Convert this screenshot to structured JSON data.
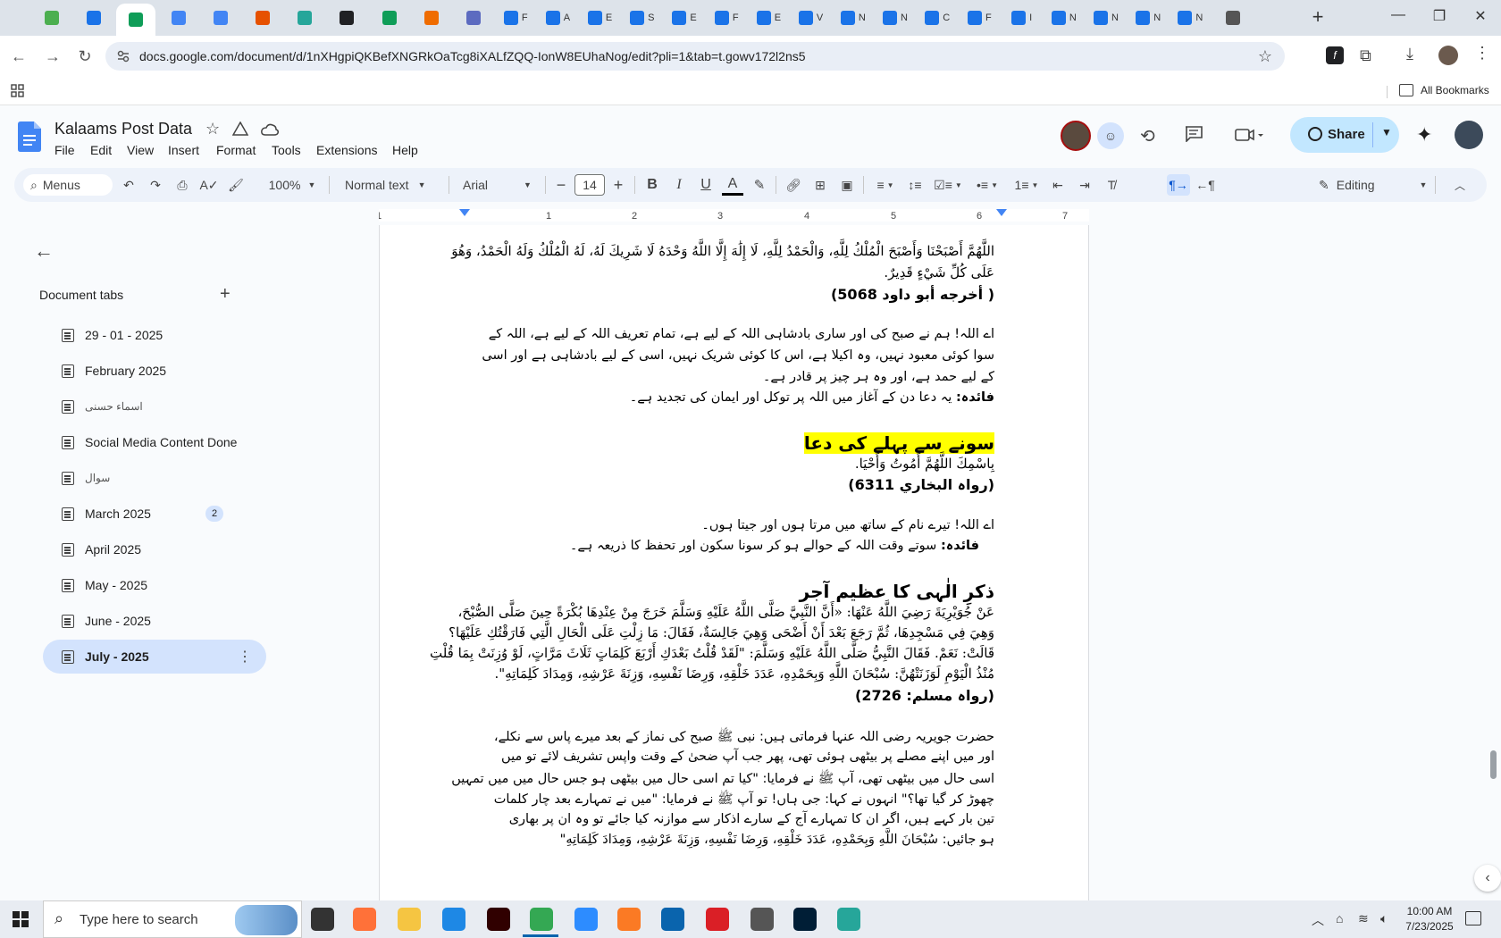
{
  "browser": {
    "tab_favicon_colors": [
      "#4caf50",
      "#1a73e8",
      "#0f9d58",
      "#4285f4",
      "#4285f4",
      "#e65100",
      "#26a69a",
      "#202124",
      "#0f9d58",
      "#ef6c00",
      "#5c6bc0",
      "#1a73e8",
      "#1a73e8",
      "#1a73e8",
      "#1a73e8",
      "#1a73e8",
      "#1a73e8",
      "#1a73e8",
      "#1a73e8",
      "#1a73e8",
      "#1a73e8",
      "#1a73e8",
      "#1a73e8",
      "#1a73e8",
      "#1a73e8",
      "#1a73e8",
      "#1a73e8",
      "#1a73e8",
      "#555"
    ],
    "tab_letters": [
      "",
      "",
      "",
      "",
      "",
      "",
      "",
      "",
      "",
      "",
      "",
      "F",
      "A",
      "E",
      "S",
      "E",
      "F",
      "E",
      "V",
      "N",
      "N",
      "C",
      "F",
      "I",
      "N",
      "N",
      "N",
      "N"
    ],
    "active_tab_index": 2,
    "url": "docs.google.com/document/d/1nXHgpiQKBefXNGRkOaTcg8iXALfZQQ-IonW8EUhaNog/edit?pli=1&tab=t.gowv172l2ns5",
    "all_bookmarks": "All Bookmarks"
  },
  "doc": {
    "title": "Kalaams Post Data",
    "menus": [
      "File",
      "Edit",
      "View",
      "Insert",
      "Format",
      "Tools",
      "Extensions",
      "Help"
    ],
    "share_label": "Share"
  },
  "toolbar": {
    "menus_label": "Menus",
    "zoom": "100%",
    "style": "Normal text",
    "font": "Arial",
    "font_size": "14",
    "editing_label": "Editing"
  },
  "ruler": {
    "numbers": [
      "1",
      "1",
      "2",
      "3",
      "4",
      "5",
      "6",
      "7"
    ]
  },
  "sidebar": {
    "header": "Document tabs",
    "items": [
      {
        "label": "29 - 01 - 2025",
        "badge": ""
      },
      {
        "label": "February 2025",
        "badge": ""
      },
      {
        "label": "اسماء حسنى",
        "badge": ""
      },
      {
        "label": "Social Media Content Done",
        "badge": ""
      },
      {
        "label": "سوال",
        "badge": ""
      },
      {
        "label": "March 2025",
        "badge": "2"
      },
      {
        "label": "April 2025",
        "badge": ""
      },
      {
        "label": "May - 2025",
        "badge": ""
      },
      {
        "label": "June - 2025",
        "badge": ""
      },
      {
        "label": "July - 2025",
        "badge": ""
      }
    ],
    "active_index": 9
  },
  "content": {
    "p1_l1": "اللَّهُمَّ أَصْبَحْنَا وَأَصْبَحَ الْمُلْكُ لِلَّهِ، وَالْحَمْدُ لِلَّهِ، لَا إِلَٰهَ إِلَّا اللَّهُ وَحْدَهُ لَا شَرِيكَ لَهُ، لَهُ الْمُلْكُ وَلَهُ الْحَمْدُ، وَهُوَ",
    "p1_l2": "عَلَى كُلِّ شَيْءٍ قَدِيرٌ.",
    "p1_ref": "( أخرجه أبو داود 5068)",
    "p2_l1": "اے اللہ! ہم نے صبح کی اور ساری بادشاہی اللہ کے لیے ہے، تمام تعریف اللہ کے لیے ہے، اللہ کے",
    "p2_l2": "سوا کوئی معبود نہیں، وہ اکیلا ہے، اس کا کوئی شریک نہیں، اسی کے لیے بادشاہی ہے اور اسی",
    "p2_l3": "کے لیے حمد ہے، اور وہ ہر چیز پر قادر ہے۔",
    "p2_benefit_label": "فائدہ:",
    "p2_benefit": "یہ دعا دن کے آغاز میں اللہ پر توکل اور ایمان کی تجدید ہے۔",
    "h1": "سونے سے پہلے کی دعا",
    "p3_l1": "بِاسْمِكَ اللَّهُمَّ أَمُوتُ وَأَحْيَا.",
    "p3_ref": "(رواہ البخاري 6311)",
    "p4_l1": "اے اللہ! تیرے نام کے ساتھ میں مرتا ہوں اور جیتا ہوں۔",
    "p4_benefit_label": "فائدہ:",
    "p4_benefit": "سوتے وقت اللہ کے حوالے ہو کر سونا سکون اور تحفظ کا ذریعہ ہے۔",
    "h2": "ذکرِ الٰہی کا عظیم آجر",
    "p5_l1": "عَنْ جُوَيْرِيَةَ رَضِيَ اللَّهُ عَنْهَا: «أَنَّ النَّبِيَّ صَلَّى اللَّهُ عَلَيْهِ وَسَلَّمَ خَرَجَ مِنْ عِنْدِهَا بُكْرَةً حِينَ صَلَّى الصُّبْحَ،",
    "p5_l2": "وَهِيَ فِي مَسْجِدِهَا، ثُمَّ رَجَعَ بَعْدَ أَنْ أَضْحَى وَهِيَ جَالِسَةٌ، فَقَالَ: مَا زِلْتِ عَلَى الْحَالِ الَّتِي فَارَقْتُكِ عَلَيْهَا؟",
    "p5_l3": "قَالَتْ: نَعَمْ. فَقَالَ النَّبِيُّ صَلَّى اللَّهُ عَلَيْهِ وَسَلَّمَ: \"لَقَدْ قُلْتُ بَعْدَكِ أَرْبَعَ كَلِمَاتٍ ثَلَاثَ مَرَّاتٍ، لَوْ وُزِنَتْ بِمَا قُلْتِ",
    "p5_l4": "مُنْذُ الْيَوْمِ لَوَزَنَتْهُنَّ: سُبْحَانَ اللَّهِ وَبِحَمْدِهِ، عَدَدَ خَلْقِهِ، وَرِضَا نَفْسِهِ، وَزِنَةَ عَرْشِهِ، وَمِدَادَ كَلِمَاتِهِ\".",
    "p5_ref": "(رواہ مسلم: 2726)",
    "p6_l1": "حضرت جویریہ رضی اللہ عنہا فرماتی ہیں: نبی ﷺ صبح کی نماز کے بعد میرے پاس سے نکلے،",
    "p6_l2": "اور میں اپنے مصلے پر بیٹھی ہوئی تھی، پھر جب آپ ضحیٰ کے وقت واپس تشریف لائے تو میں",
    "p6_l3": "اسی حال میں بیٹھی تھی، آپ ﷺ نے فرمایا: \"کیا تم اسی حال میں بیٹھی ہو جس حال میں میں تمہیں",
    "p6_l4": "چھوڑ کر گیا تھا؟\" انہوں نے کہا: جی ہاں! تو آپ ﷺ نے فرمایا: \"میں نے تمہارے بعد چار کلمات",
    "p6_l5": "تین بار کہے ہیں، اگر ان کا تمہارے آج کے سارے اذکار سے موازنہ کیا جائے تو وہ ان پر بھاری",
    "p6_l6": "ہو جائیں: سُبْحَانَ اللَّهِ وَبِحَمْدِهِ، عَدَدَ خَلْقِهِ، وَرِضَا نَفْسِهِ، وَزِنَةَ عَرْشِهِ، وَمِدَادَ كَلِمَاتِهِ\""
  },
  "taskbar": {
    "search_placeholder": "Type here to search",
    "time": "10:00 AM",
    "date": "7/23/2025"
  }
}
